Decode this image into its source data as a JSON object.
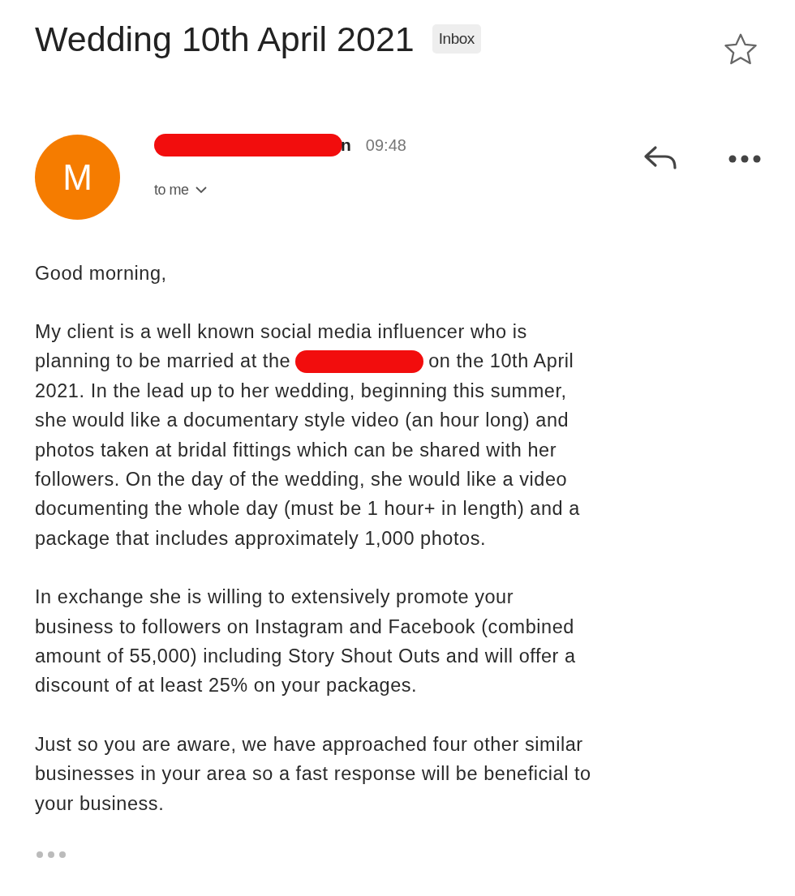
{
  "subject": "Wedding 10th April 2021",
  "label": "Inbox",
  "starred": false,
  "sender": {
    "initial": "M",
    "name_end": "n",
    "time": "09:48",
    "recipient": "to me"
  },
  "body": [
    {
      "lines": [
        [
          {
            "kind": "text",
            "text": "Good morning,"
          }
        ]
      ]
    },
    {
      "lines": [
        [
          {
            "kind": "text",
            "text": "My client is a well known social media influencer who is"
          }
        ],
        [
          {
            "kind": "text",
            "text": "planning to be married at the"
          },
          {
            "kind": "redaction"
          },
          {
            "kind": "text",
            "text": "on the 10th April"
          }
        ],
        [
          {
            "kind": "text",
            "text": "2021. In the lead up to her wedding, beginning this summer,"
          }
        ],
        [
          {
            "kind": "text",
            "text": "she would like a documentary style video (an hour long) and"
          }
        ],
        [
          {
            "kind": "text",
            "text": "photos taken at bridal fittings which can be shared with her"
          }
        ],
        [
          {
            "kind": "text",
            "text": "followers. On the day of the wedding, she would like a video"
          }
        ],
        [
          {
            "kind": "text",
            "text": "documenting the whole day (must be 1 hour+ in length) and a"
          }
        ],
        [
          {
            "kind": "text",
            "text": "package that includes approximately 1,000 photos."
          }
        ]
      ]
    },
    {
      "lines": [
        [
          {
            "kind": "text",
            "text": "In exchange she is willing to extensively promote your"
          }
        ],
        [
          {
            "kind": "text",
            "text": "business to followers on Instagram and Facebook (combined"
          }
        ],
        [
          {
            "kind": "text",
            "text": "amount of 55,000) including Story Shout Outs and will offer a"
          }
        ],
        [
          {
            "kind": "text",
            "text": "discount of at least 25% on your packages."
          }
        ]
      ]
    },
    {
      "lines": [
        [
          {
            "kind": "text",
            "text": "Just so you are aware, we have approached four other similar"
          }
        ],
        [
          {
            "kind": "text",
            "text": "businesses in your area so a fast response will be beneficial to"
          }
        ],
        [
          {
            "kind": "text",
            "text": "your business."
          }
        ]
      ]
    }
  ]
}
